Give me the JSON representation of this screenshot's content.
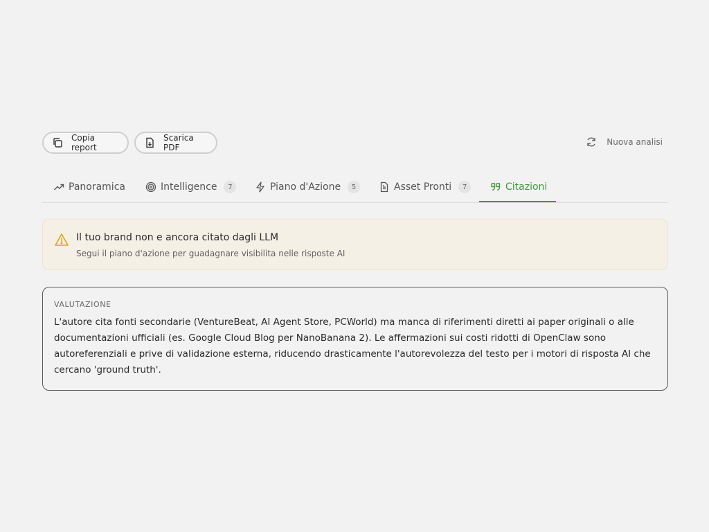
{
  "toolbar": {
    "copy_report": "Copia report",
    "download_pdf": "Scarica PDF",
    "new_analysis": "Nuova analisi"
  },
  "tabs": [
    {
      "label": "Panoramica",
      "icon": "trending-up-icon"
    },
    {
      "label": "Intelligence",
      "icon": "target-icon",
      "badge": "7"
    },
    {
      "label": "Piano d'Azione",
      "icon": "lightning-icon",
      "badge": "5"
    },
    {
      "label": "Asset Pronti",
      "icon": "document-icon",
      "badge": "7"
    },
    {
      "label": "Citazioni",
      "icon": "quote-icon",
      "active": true
    }
  ],
  "alert": {
    "title": "Il tuo brand non e ancora citato dagli LLM",
    "subtitle": "Segui il piano d'azione per guadagnare visibilita nelle risposte AI"
  },
  "evaluation": {
    "label": "VALUTAZIONE",
    "text": "L'autore cita fonti secondarie (VentureBeat, AI Agent Store, PCWorld) ma manca di riferimenti diretti ai paper originali o alle documentazioni ufficiali (es. Google Cloud Blog per NanoBanana 2). Le affermazioni sui costi ridotti di OpenClaw sono autoreferenziali e prive di validazione esterna, riducendo drasticamente l'autorevolezza del testo per i motori di risposta AI che cercano 'ground truth'."
  },
  "colors": {
    "accent": "#3e9a3a",
    "warning": "#e0a21a",
    "alert_bg": "#f5f0e6"
  }
}
